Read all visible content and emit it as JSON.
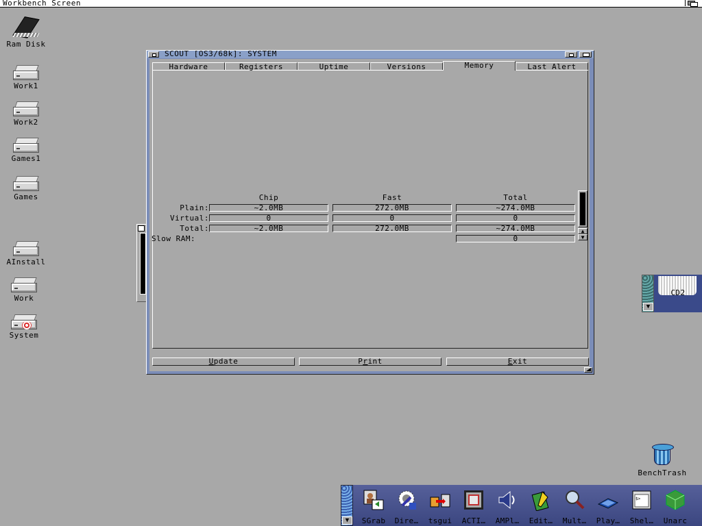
{
  "screen": {
    "title": "Workbench Screen"
  },
  "desktop_icons": [
    {
      "name": "ram-disk-icon",
      "label": "Ram Disk"
    },
    {
      "name": "work1-drive-icon",
      "label": "Work1"
    },
    {
      "name": "work2-drive-icon",
      "label": "Work2"
    },
    {
      "name": "games1-drive-icon",
      "label": "Games1"
    },
    {
      "name": "games-drive-icon",
      "label": "Games"
    },
    {
      "name": "ainstall-drive-icon",
      "label": "AInstall"
    },
    {
      "name": "work-drive-icon",
      "label": "Work"
    },
    {
      "name": "system-drive-icon",
      "label": "System"
    }
  ],
  "window": {
    "title": "SCOUT [OS3/68k]: SYSTEM",
    "tabs": [
      {
        "label": "Hardware",
        "active": false
      },
      {
        "label": "Registers",
        "active": false
      },
      {
        "label": "Uptime",
        "active": false
      },
      {
        "label": "Versions",
        "active": false
      },
      {
        "label": "Memory",
        "active": true
      },
      {
        "label": "Last Alert",
        "active": false
      }
    ],
    "memory": {
      "columns": [
        "Chip",
        "Fast",
        "Total"
      ],
      "rows": [
        {
          "label": "Plain:",
          "chip": "~2.0MB",
          "fast": "272.0MB",
          "total": "~274.0MB"
        },
        {
          "label": "Virtual:",
          "chip": "0",
          "fast": "0",
          "total": "0"
        },
        {
          "label": "Total:",
          "chip": "~2.0MB",
          "fast": "272.0MB",
          "total": "~274.0MB"
        }
      ],
      "slow_ram": {
        "label": "Slow RAM:",
        "total": "0"
      }
    },
    "buttons": {
      "update": {
        "hotkey": "U",
        "rest": "pdate"
      },
      "print": {
        "pre": "P",
        "hotkey": "r",
        "rest": "int"
      },
      "exit": {
        "hotkey": "E",
        "rest": "xit"
      }
    }
  },
  "cd2": {
    "label": "CD2"
  },
  "trash": {
    "label": "BenchTrash"
  },
  "dock": {
    "apps": [
      {
        "name": "sgrab-icon",
        "label": "SGrab"
      },
      {
        "name": "directory-opus-icon",
        "label": "Dire…"
      },
      {
        "name": "tsgui-icon",
        "label": "tsgui"
      },
      {
        "name": "actions-icon",
        "label": "ACTI…"
      },
      {
        "name": "amplifier-icon",
        "label": "AMPl…"
      },
      {
        "name": "editor-icon",
        "label": "Edit…"
      },
      {
        "name": "multiview-icon",
        "label": "Mult…"
      },
      {
        "name": "player-icon",
        "label": "Play…"
      },
      {
        "name": "shell-icon",
        "label": "Shel…"
      },
      {
        "name": "unarc-icon",
        "label": "Unarc"
      }
    ]
  }
}
